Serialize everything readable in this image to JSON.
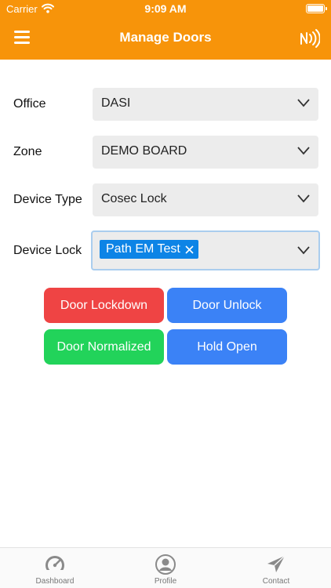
{
  "status_bar": {
    "carrier": "Carrier",
    "time": "9:09 AM"
  },
  "header": {
    "title": "Manage Doors"
  },
  "form": {
    "office": {
      "label": "Office",
      "value": "DASI"
    },
    "zone": {
      "label": "Zone",
      "value": "DEMO BOARD"
    },
    "device_type": {
      "label": "Device Type",
      "value": "Cosec Lock"
    },
    "device_lock": {
      "label": "Device Lock",
      "selected_chip": "Path EM Test"
    }
  },
  "actions": {
    "door_lockdown": "Door Lockdown",
    "door_unlock": "Door Unlock",
    "door_normalized": "Door Normalized",
    "hold_open": "Hold Open"
  },
  "tab_bar": {
    "items": [
      {
        "label": "Dashboard",
        "icon": "speedometer-icon"
      },
      {
        "label": "Profile",
        "icon": "user-icon"
      },
      {
        "label": "Contact",
        "icon": "paper-plane-icon"
      }
    ]
  },
  "colors": {
    "brand": "#f7940a",
    "danger": "#ef4444",
    "primary": "#3b82f6",
    "success": "#22d35a",
    "chip": "#0d84e6"
  }
}
